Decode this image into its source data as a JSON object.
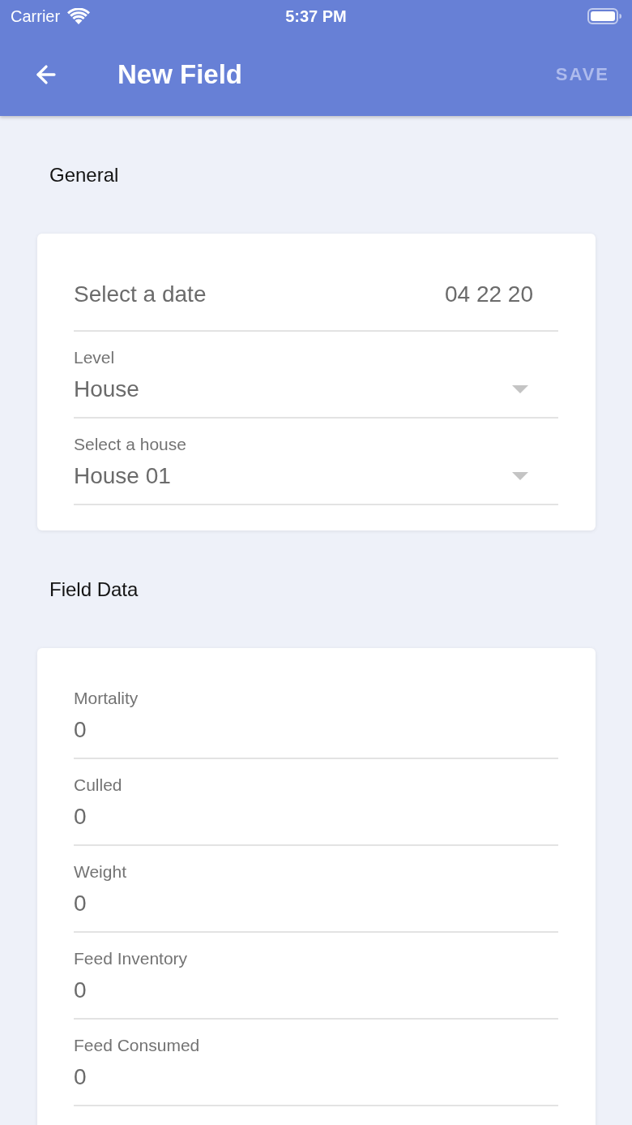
{
  "status_bar": {
    "carrier": "Carrier",
    "time": "5:37 PM"
  },
  "header": {
    "title": "New Field",
    "save_button": {
      "label": "SAVE",
      "disabled": true
    }
  },
  "sections": [
    {
      "title": "General",
      "fields": [
        {
          "kind": "date",
          "label": "Select a date",
          "value": "04 22 20"
        },
        {
          "kind": "dropdown",
          "label": "Level",
          "value": "House"
        },
        {
          "kind": "dropdown",
          "label": "Select a house",
          "value": "House 01"
        }
      ]
    },
    {
      "title": "Field Data",
      "fields": [
        {
          "kind": "number",
          "label": "Mortality",
          "value": "0"
        },
        {
          "kind": "number",
          "label": "Culled",
          "value": "0"
        },
        {
          "kind": "number",
          "label": "Weight",
          "value": "0"
        },
        {
          "kind": "number",
          "label": "Feed Inventory",
          "value": "0"
        },
        {
          "kind": "number",
          "label": "Feed Consumed",
          "value": "0"
        }
      ]
    }
  ]
}
